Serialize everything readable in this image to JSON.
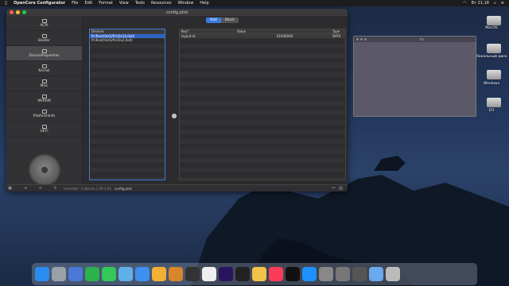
{
  "menubar": {
    "app_name": "OpenCore Configurator",
    "menus": [
      "File",
      "Edit",
      "Format",
      "View",
      "Tools",
      "Resources",
      "Window",
      "Help"
    ],
    "clock": "Вт 21:18"
  },
  "window": {
    "title": "config.plist",
    "sidebar": [
      {
        "label": "ACPI"
      },
      {
        "label": "Booter"
      },
      {
        "label": "DeviceProperties",
        "active": true
      },
      {
        "label": "Kernel"
      },
      {
        "label": "Misc"
      },
      {
        "label": "NVRAM"
      },
      {
        "label": "PlatformInfo"
      },
      {
        "label": "UEFI"
      }
    ],
    "segment": {
      "add": "Add",
      "block": "Block"
    },
    "devices": {
      "header": "Devices",
      "rows": [
        "PciRoot(0x0)/Pci(0x1b,0x0)",
        "PciRoot(0x0)/Pci(0x2,0x0)"
      ]
    },
    "properties": {
      "headers": {
        "key": "Key*",
        "value": "Value",
        "type": "Type"
      },
      "rows": [
        {
          "key": "layout-id",
          "value": "01000000",
          "type": "DATA"
        }
      ]
    },
    "status": {
      "path_hint": "lamerdet · 3 Iwlsnia 1.IW 3:36",
      "file": "config.plist"
    }
  },
  "desktop": {
    "panel_title": "Yos",
    "icons": [
      {
        "label": "MacOS"
      },
      {
        "label": "Локальный диск"
      },
      {
        "label": "Windows"
      },
      {
        "label": "EFI"
      }
    ]
  },
  "dock_apps": [
    "Finder",
    "Launchpad",
    "Preview",
    "Facetime",
    "Messages",
    "Maps",
    "Mail",
    "Photos",
    "Books",
    "Music",
    "Calendar",
    "Premiere",
    "Terminal",
    "Notes",
    "Music2",
    "AppleTV",
    "AppStore",
    "Settings",
    "DiskUtility",
    "Activity",
    "Files",
    "Trash"
  ]
}
